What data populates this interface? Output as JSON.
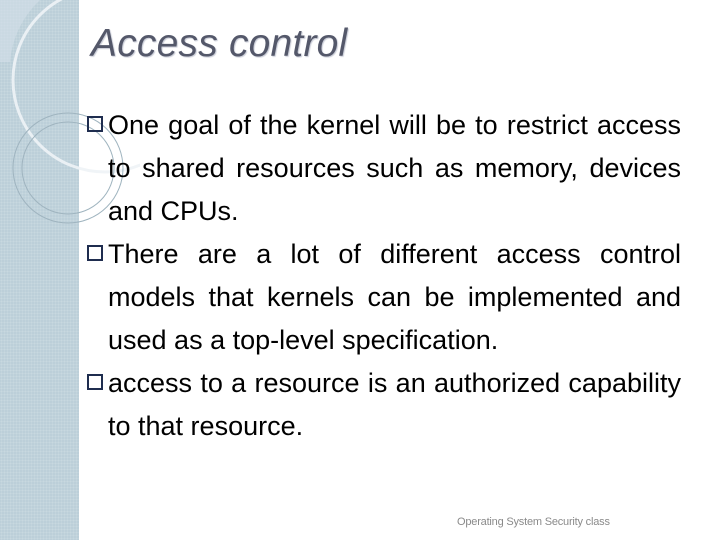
{
  "slide": {
    "title": "Access control",
    "bullets": [
      {
        "icon": "square-bullet-icon",
        "text": "One goal of the kernel will be to restrict access to shared resources such as memory, devices and CPUs."
      },
      {
        "icon": "square-bullet-icon",
        "text": "There are a lot of different access control models that kernels can be implemented and used as a top-level specification."
      },
      {
        "icon": "square-bullet-icon",
        "text": "access to a resource is an authorized capability to that resource."
      }
    ],
    "footer": "Operating System Security class"
  },
  "colors": {
    "sidebar": "#bccfd9",
    "title": "#54586a",
    "bullet_box": "#1f2d4f",
    "footer": "#8a8a8a"
  }
}
